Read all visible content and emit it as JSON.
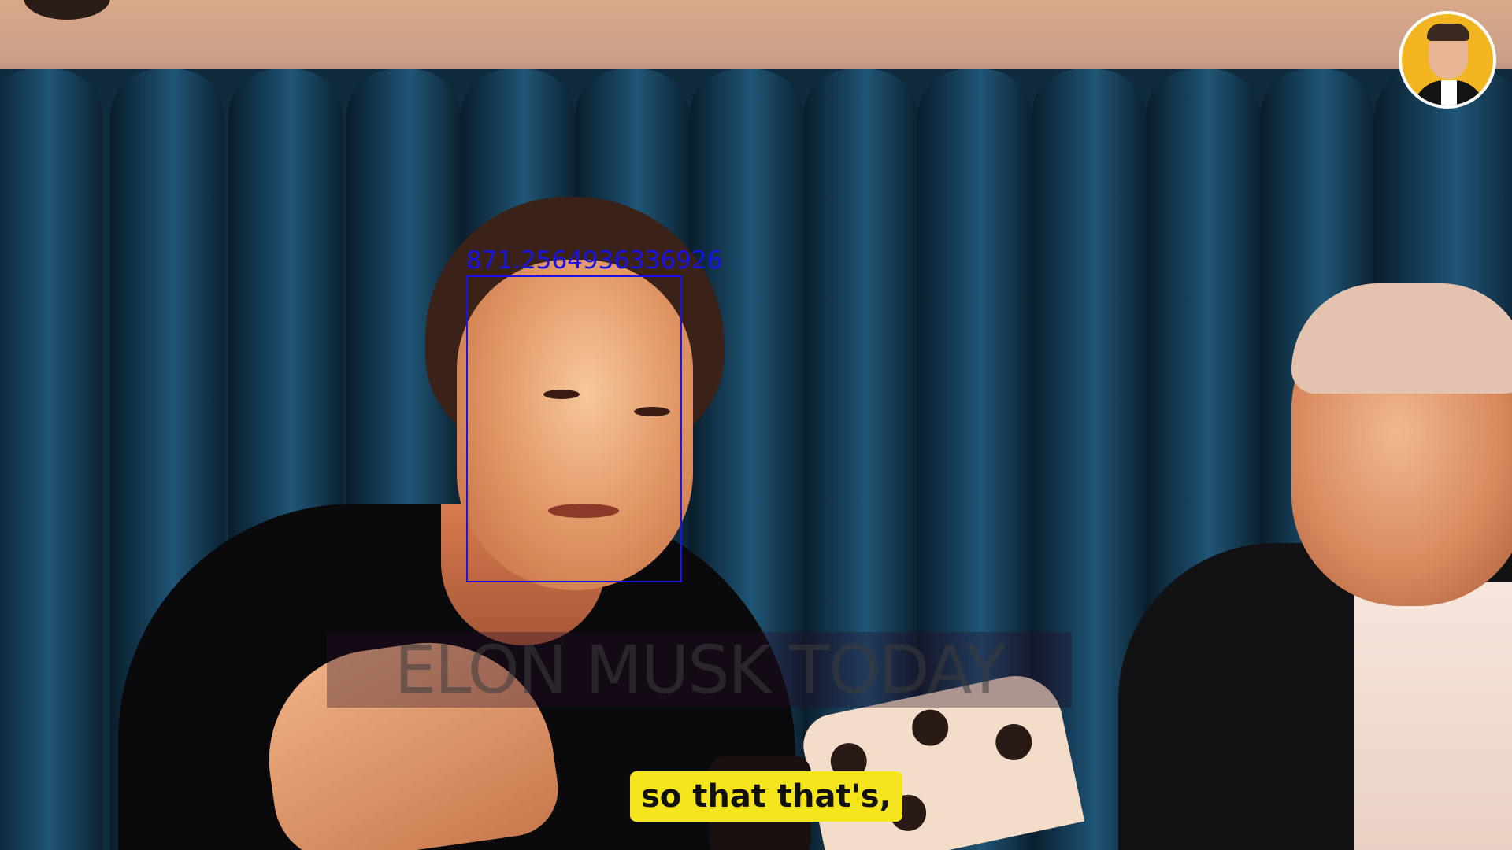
{
  "scene": {
    "description_hidden": "",
    "watermark": {
      "text": "ELON MUSK TODAY"
    },
    "detection": {
      "label": "871.2564936336926",
      "color": "#1a12e6"
    },
    "caption": {
      "text": "so that that's,",
      "background": "#f5e51c"
    },
    "channel_avatar": {
      "icon": "channel-avatar-icon",
      "background": "#f2b51f"
    }
  }
}
